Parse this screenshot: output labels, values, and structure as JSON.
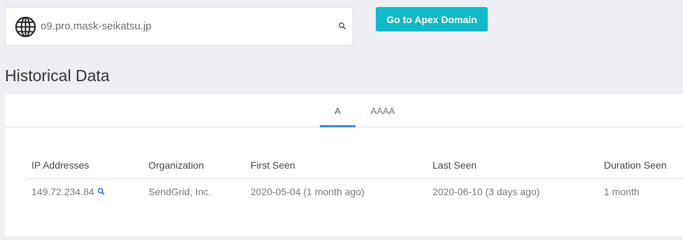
{
  "search": {
    "value": "o9.pro.mask-seikatsu.jp",
    "icon": "globe-icon",
    "action_icon": "search-icon"
  },
  "apex_button": {
    "label": "Go to Apex Domain",
    "color": "#12b9c6"
  },
  "section": {
    "title": "Historical Data"
  },
  "tabs": [
    {
      "label": "A",
      "active": true
    },
    {
      "label": "AAAA",
      "active": false
    }
  ],
  "table": {
    "headers": [
      "IP Addresses",
      "Organization",
      "First Seen",
      "Last Seen",
      "Duration Seen"
    ],
    "rows": [
      {
        "ip": "149.72.234.84",
        "organization": "SendGrid, Inc.",
        "first_seen": "2020-05-04 (1 month ago)",
        "last_seen": "2020-06-10 (3 days ago)",
        "duration": "1 month"
      }
    ]
  },
  "colors": {
    "accent_tab": "#3d85d1",
    "background": "#eeeef5"
  }
}
